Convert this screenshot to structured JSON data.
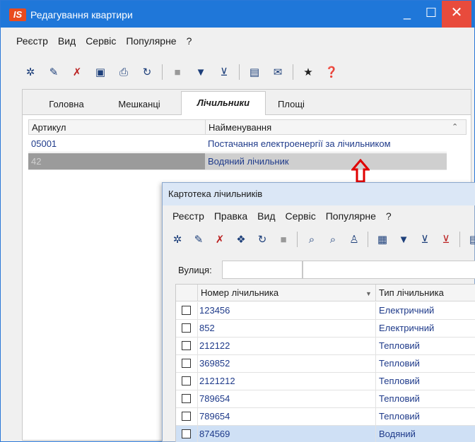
{
  "main": {
    "title": "Редагування квартири",
    "logo": "IS",
    "controls": {
      "minimize": "_",
      "maximize": "☐",
      "close": "✕"
    },
    "menu": [
      "Реєстр",
      "Вид",
      "Сервіс",
      "Популярне",
      "?"
    ],
    "toolbar_icons": [
      "new-icon",
      "edit-icon",
      "delete-icon",
      "save-icon",
      "print-icon",
      "refresh-icon",
      "block-icon",
      "filter-icon",
      "filter-clear-icon",
      "form-icon",
      "mail-icon",
      "star-icon",
      "help-icon"
    ],
    "tabs": [
      {
        "label": "Головна",
        "active": false
      },
      {
        "label": "Мешканці",
        "active": false
      },
      {
        "label": "Лічильники",
        "active": true
      },
      {
        "label": "Площі",
        "active": false
      }
    ],
    "grid": {
      "columns": [
        "Артикул",
        "Найменування"
      ],
      "rows": [
        {
          "article": "05001",
          "name": "Постачання електроенергії за лічильником",
          "selected": false
        },
        {
          "article": "42",
          "name": "Водяний лічильник",
          "selected": true
        }
      ]
    },
    "accent": "#1f77d9",
    "arrow_color": "#e00000"
  },
  "sub": {
    "title": "Картотека лічильників",
    "menu": [
      "Реєстр",
      "Правка",
      "Вид",
      "Сервіс",
      "Популярне",
      "?"
    ],
    "street_label": "Вулиця:",
    "street_value": "",
    "columns": [
      "Номер лічильника",
      "Тип лічильника"
    ],
    "rows": [
      {
        "number": "123456",
        "type": "Електричний"
      },
      {
        "number": "852",
        "type": "Електричний"
      },
      {
        "number": "212122",
        "type": "Тепловий"
      },
      {
        "number": "369852",
        "type": "Тепловий"
      },
      {
        "number": "2121212",
        "type": "Тепловий"
      },
      {
        "number": "789654",
        "type": "Тепловий"
      },
      {
        "number": "789654",
        "type": "Тепловий"
      },
      {
        "number": "874569",
        "type": "Водяний"
      }
    ]
  }
}
